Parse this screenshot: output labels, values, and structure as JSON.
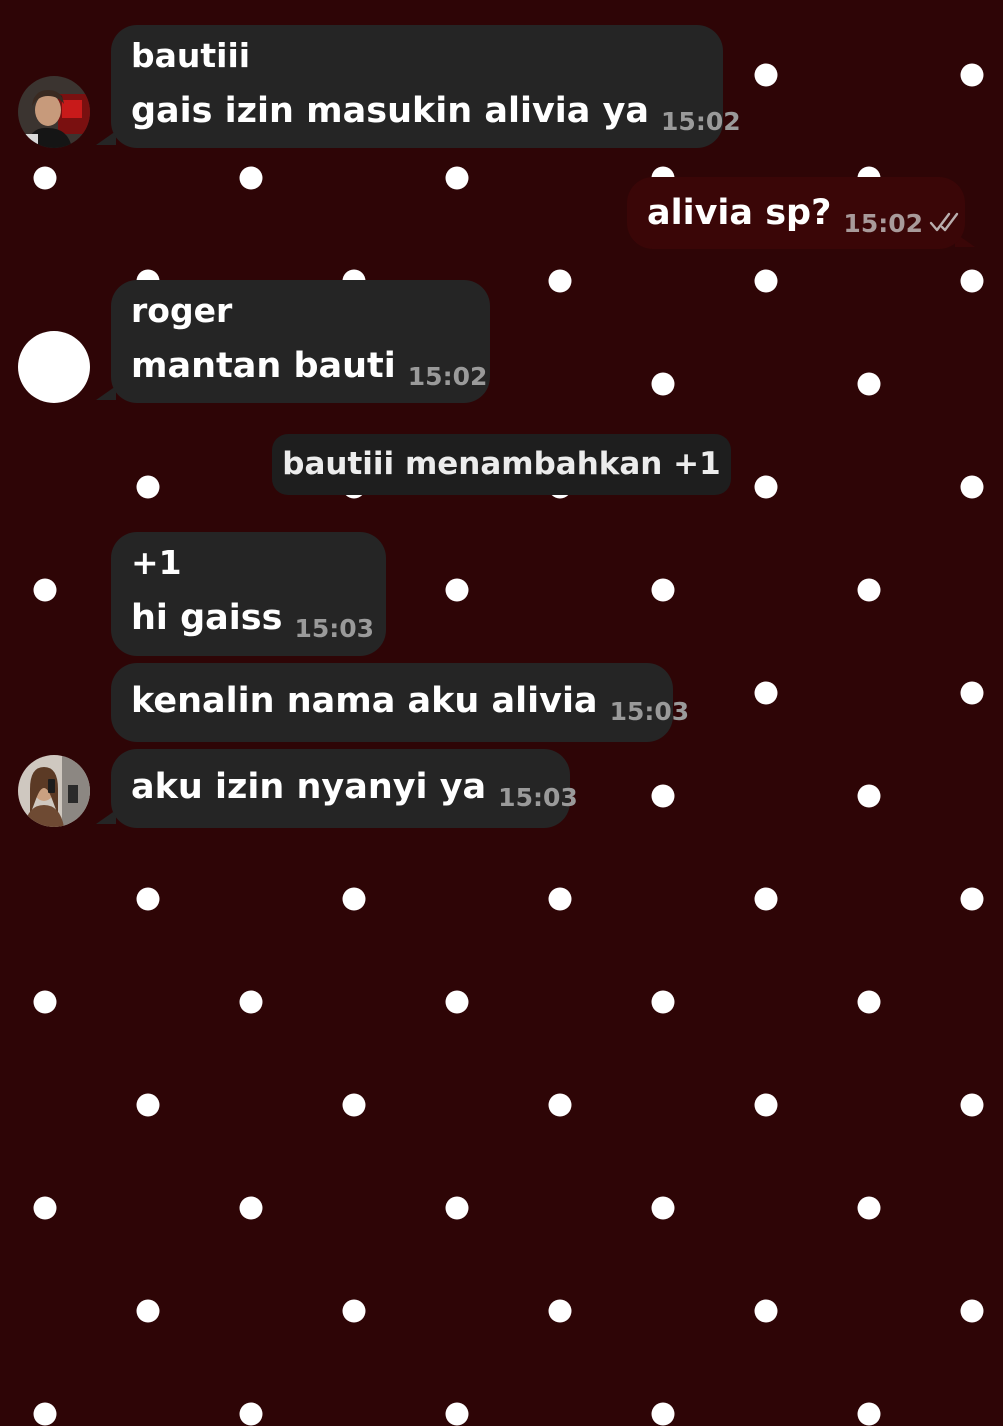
{
  "theme": {
    "background": "#2e0506",
    "dot_color": "#ffffff",
    "incoming_bubble": "#252525",
    "outgoing_bubble": "#3a0607",
    "service_bubble": "#1e1e1e",
    "time_color": "#9a9a9a"
  },
  "messages": [
    {
      "direction": "incoming",
      "sender": "bautiii",
      "text": "gais izin masukin alivia ya",
      "time": "15:02",
      "avatar": "photo-avatar"
    },
    {
      "direction": "outgoing",
      "text": "alivia sp?",
      "time": "15:02",
      "status_icon": "double-check-icon"
    },
    {
      "direction": "incoming",
      "sender": "roger",
      "text": "mantan bauti",
      "time": "15:02",
      "avatar": "blank-avatar"
    },
    {
      "direction": "service",
      "text": "bautiii menambahkan +1"
    },
    {
      "direction": "incoming",
      "sender": "+1",
      "text": "hi gaiss",
      "time": "15:03"
    },
    {
      "direction": "incoming",
      "text": "kenalin nama aku alivia",
      "time": "15:03"
    },
    {
      "direction": "incoming",
      "text": "aku izin nyanyi ya",
      "time": "15:03",
      "avatar": "photo-avatar"
    }
  ]
}
